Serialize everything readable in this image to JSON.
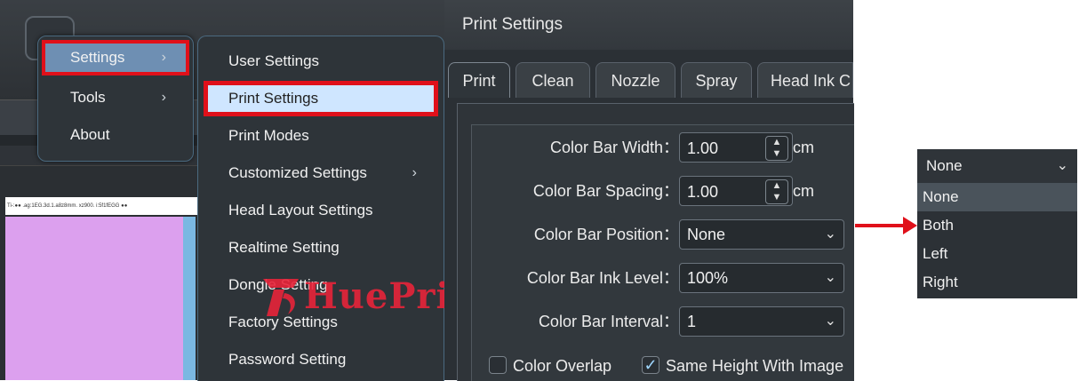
{
  "main_menu": {
    "items": [
      {
        "label": "Settings",
        "has_submenu": true,
        "highlighted": true
      },
      {
        "label": "Tools",
        "has_submenu": true
      },
      {
        "label": "About",
        "has_submenu": false
      }
    ]
  },
  "sub_menu": {
    "items": [
      {
        "label": "User Settings"
      },
      {
        "label": "Print Settings",
        "highlighted": true
      },
      {
        "label": "Print Modes"
      },
      {
        "label": "Customized Settings",
        "has_submenu": true
      },
      {
        "label": "Head Layout Settings"
      },
      {
        "label": "Realtime Setting"
      },
      {
        "label": "Dongle Setting"
      },
      {
        "label": "Factory Settings"
      },
      {
        "label": "Password Setting"
      }
    ]
  },
  "status_strip": {
    "text": "Ti-:●●  .ag:1EG.3d.1.a8z8mm. xz900.  i:5f1fEGG ●●"
  },
  "watermark": {
    "text": "HuePrime"
  },
  "dialog": {
    "title": "Print Settings",
    "tabs": [
      {
        "label": "Print",
        "active": true
      },
      {
        "label": "Clean"
      },
      {
        "label": "Nozzle"
      },
      {
        "label": "Spray"
      },
      {
        "label": "Head Ink C"
      }
    ],
    "colon": "：",
    "fields": {
      "bar_width": {
        "label": "Color Bar Width",
        "value": "1.00",
        "unit": "cm"
      },
      "bar_spacing": {
        "label": "Color Bar Spacing",
        "value": "1.00",
        "unit": "cm"
      },
      "bar_position": {
        "label": "Color Bar Position",
        "value": "None"
      },
      "bar_ink_level": {
        "label": "Color Bar Ink Level",
        "value": "100%"
      },
      "bar_interval": {
        "label": "Color Bar Interval",
        "value": "1"
      }
    },
    "checkboxes": {
      "color_overlap": {
        "label": "Color Overlap",
        "checked": false
      },
      "same_height": {
        "label": "Same Height With Image",
        "checked": true
      }
    }
  },
  "position_dropdown": {
    "selected": "None",
    "options": [
      "None",
      "Both",
      "Left",
      "Right"
    ],
    "hovered_index": 0
  },
  "colors": {
    "highlight_red": "#e0101a",
    "menu_bg": "#2e3439",
    "selected_item": "#cfe6ff",
    "settings_item": "#6e8fb3"
  }
}
